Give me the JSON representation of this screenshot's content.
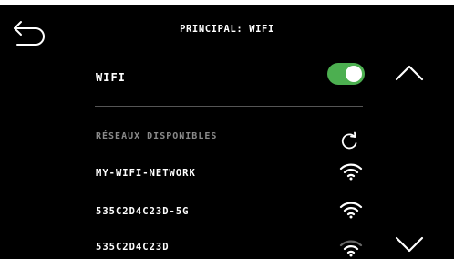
{
  "header": {
    "title": "PRINCIPAL: WIFI"
  },
  "wifi": {
    "label": "WIFI",
    "enabled": true,
    "toggle_color": "#4caf50"
  },
  "networks": {
    "section_label": "RÉSEAUX DISPONIBLES",
    "items": [
      {
        "name": "MY-WIFI-NETWORK",
        "signal": "strong"
      },
      {
        "name": "535C2D4C23D-5G",
        "signal": "strong"
      },
      {
        "name": "535C2D4C23D",
        "signal": "weak"
      }
    ]
  },
  "icons": {
    "back": "back-arrow-icon",
    "refresh": "refresh-icon",
    "wifi_signal": "wifi-signal-icon",
    "scroll_up": "chevron-up-icon",
    "scroll_down": "chevron-down-icon"
  }
}
